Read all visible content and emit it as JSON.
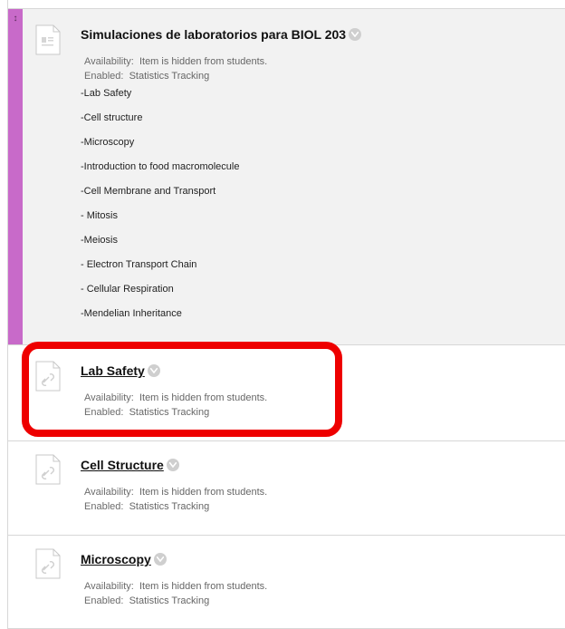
{
  "folder": {
    "title": "Simulaciones de laboratorios para BIOL 203",
    "availability_label": "Availability:",
    "availability_value": "Item is hidden from students.",
    "enabled_label": "Enabled:",
    "enabled_value": "Statistics Tracking",
    "description": [
      "-Lab Safety",
      "-Cell structure",
      "-Microscopy",
      "-Introduction to food macromolecule",
      "-Cell Membrane and Transport",
      "- Mitosis",
      "-Meiosis",
      "- Electron Transport Chain",
      "- Cellular Respiration",
      "-Mendelian Inheritance"
    ]
  },
  "links": [
    {
      "title": "Lab Safety",
      "availability_label": "Availability:",
      "availability_value": "Item is hidden from students.",
      "enabled_label": "Enabled:",
      "enabled_value": "Statistics Tracking"
    },
    {
      "title": "Cell Structure",
      "availability_label": "Availability:",
      "availability_value": "Item is hidden from students.",
      "enabled_label": "Enabled:",
      "enabled_value": "Statistics Tracking"
    },
    {
      "title": "Microscopy",
      "availability_label": "Availability:",
      "availability_value": "Item is hidden from students.",
      "enabled_label": "Enabled:",
      "enabled_value": "Statistics Tracking"
    }
  ],
  "colors": {
    "drag_strip": "#c86ac9",
    "highlight": "#ee0000"
  }
}
